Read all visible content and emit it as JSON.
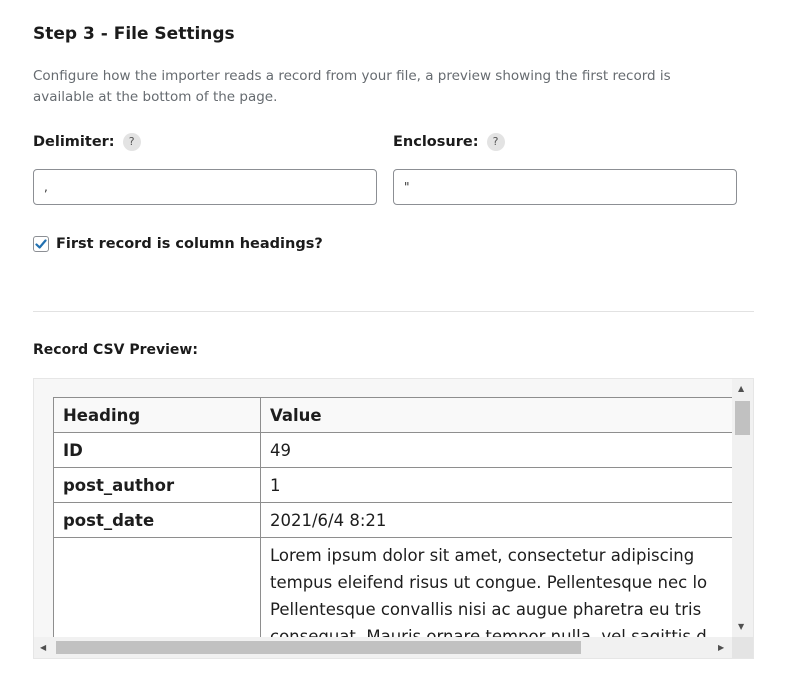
{
  "step": {
    "title": "Step 3 - File Settings",
    "description": "Configure how the importer reads a record from your file, a preview showing the first record is available at the bottom of the page."
  },
  "delimiter": {
    "label": "Delimiter:",
    "help": "?",
    "value": ","
  },
  "enclosure": {
    "label": "Enclosure:",
    "help": "?",
    "value": "\""
  },
  "first_record": {
    "label": "First record is column headings?",
    "checked": true
  },
  "preview": {
    "label": "Record CSV Preview:",
    "columns": [
      "Heading",
      "Value"
    ],
    "rows": [
      {
        "heading": "ID",
        "value": "49"
      },
      {
        "heading": "post_author",
        "value": "1"
      },
      {
        "heading": "post_date",
        "value": "2021/6/4 8:21"
      }
    ],
    "long_row": {
      "heading": "",
      "lines": [
        "Lorem ipsum dolor sit amet, consectetur adipiscing",
        "tempus eleifend risus ut congue. Pellentesque nec lo",
        "Pellentesque convallis nisi ac augue pharetra eu tris",
        "consequat. Mauris ornare tempor nulla, vel sagittis d"
      ]
    }
  },
  "colors": {
    "checkbox_accent": "#2271b1"
  }
}
